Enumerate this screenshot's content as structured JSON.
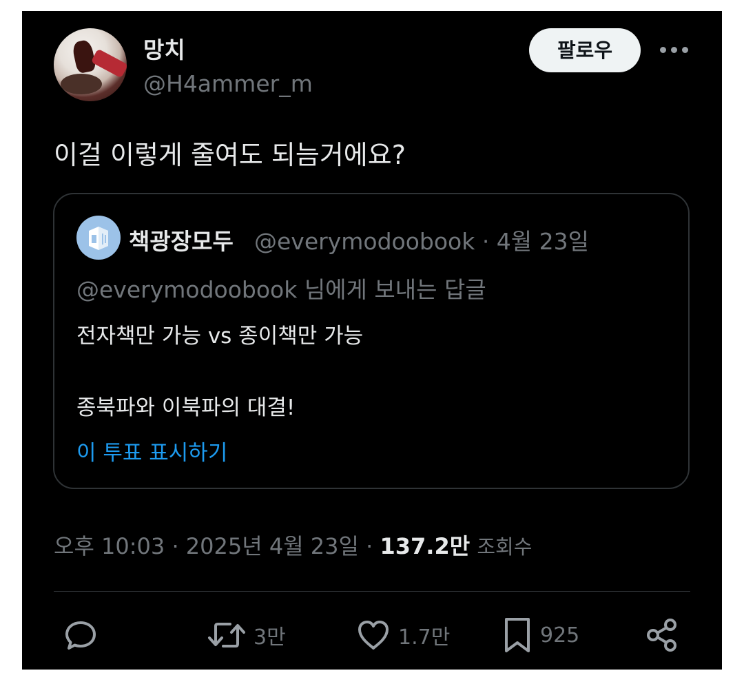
{
  "author": {
    "display_name": "망치",
    "handle": "@H4ammer_m"
  },
  "header": {
    "follow_label": "팔로우"
  },
  "tweet": {
    "text": "이걸 이렇게 줄여도 되늠거에요?"
  },
  "quoted": {
    "name": "책광장모두",
    "handle_date": "@everymodoobook · 4월 23일",
    "reply_to": "@everymodoobook 님에게 보내는 답글",
    "line1": "전자책만 가능 vs 종이책만 가능",
    "line2": "종북파와 이북파의 대결!",
    "poll_link": "이 투표 표시하기"
  },
  "meta": {
    "time_date": "오후 10:03 · 2025년 4월 23일 · ",
    "views_count": "137.2만",
    "views_label": "조회수"
  },
  "actions": {
    "retweets": "3만",
    "likes": "1.7만",
    "bookmarks": "925"
  },
  "colors": {
    "background": "#000000",
    "text": "#e7e9ea",
    "secondary": "#71767b",
    "link": "#1d9bf0",
    "border": "#2f3336"
  },
  "icons": [
    "more-icon",
    "reply-icon",
    "retweet-icon",
    "like-icon",
    "bookmark-icon",
    "share-icon"
  ]
}
